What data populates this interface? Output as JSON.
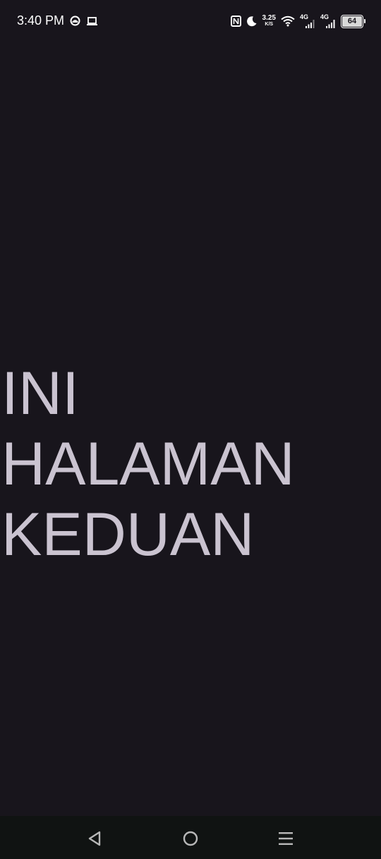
{
  "status_bar": {
    "time": "3:40 PM",
    "icons_left": [
      "app-notification-icon",
      "laptop-icon"
    ],
    "nfc_icon": "nfc-icon",
    "dnd_icon": "moon-icon",
    "speed_value": "3.25",
    "speed_unit": "K/S",
    "wifi_icon": "wifi-icon",
    "sim1_label": "4G",
    "sim2_label": "4G",
    "battery_level": "64"
  },
  "main": {
    "heading": "INI HALAMAN KEDUAN"
  },
  "nav_bar": {
    "back_icon": "back-triangle-icon",
    "home_icon": "home-circle-icon",
    "recents_icon": "menu-lines-icon"
  },
  "colors": {
    "background": "#18151c",
    "text": "#cac3d0",
    "nav_background": "#101312"
  }
}
